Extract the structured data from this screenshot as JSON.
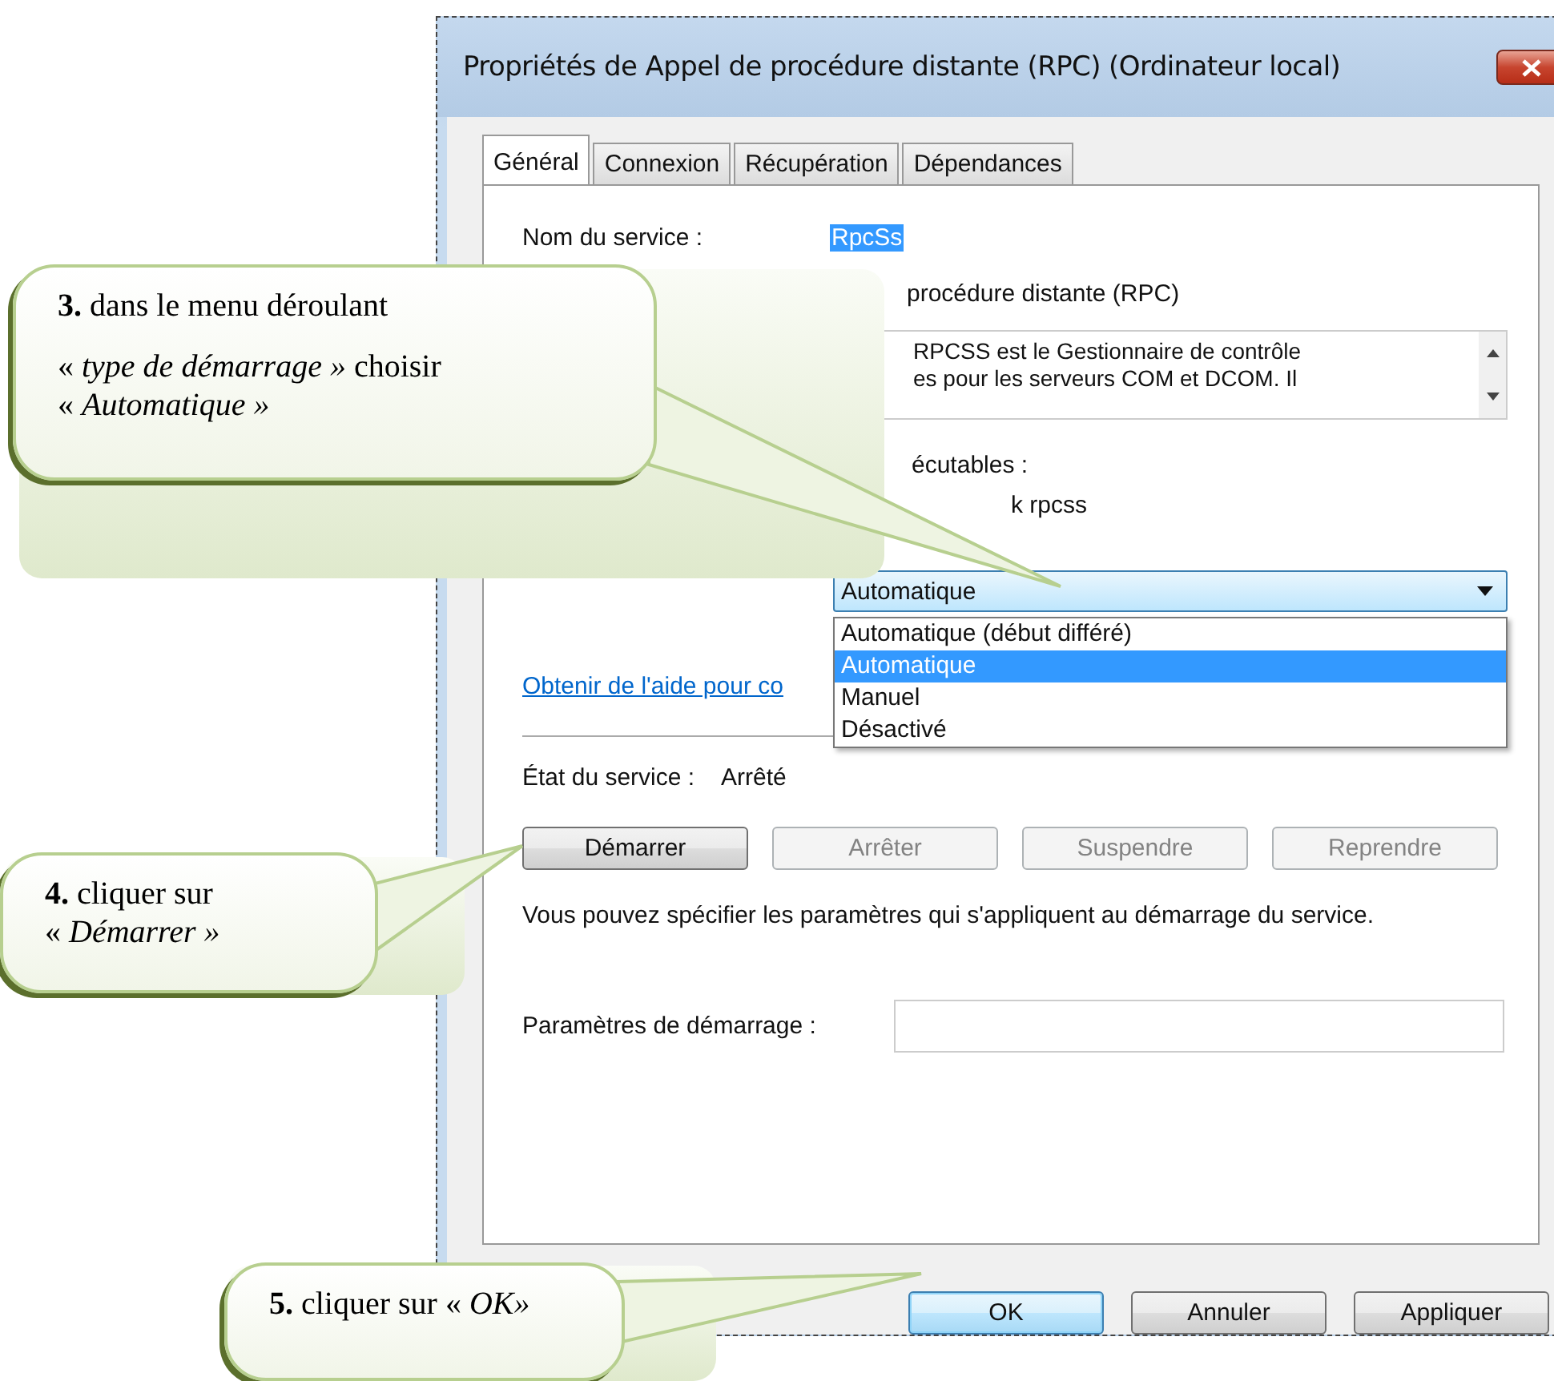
{
  "window": {
    "title": "Propriétés de Appel de procédure distante (RPC) (Ordinateur local)",
    "tabs": [
      {
        "label": "Général",
        "selected": true
      },
      {
        "label": "Connexion",
        "selected": false
      },
      {
        "label": "Récupération",
        "selected": false
      },
      {
        "label": "Dépendances",
        "selected": false
      }
    ]
  },
  "general": {
    "service_name_label": "Nom du service :",
    "service_name": "RpcSs",
    "display_name_fragment": "procédure distante (RPC)",
    "description_lines": [
      "RPCSS est le Gestionnaire de contrôle",
      "es pour les serveurs COM et DCOM. Il"
    ],
    "executable_label_fragment": "écutables :",
    "executable_fragment": "k rpcss",
    "startup_type": {
      "value": "Automatique",
      "expanded": true,
      "options": [
        {
          "label": "Automatique (début différé)",
          "selected": false
        },
        {
          "label": "Automatique",
          "selected": true
        },
        {
          "label": "Manuel",
          "selected": false
        },
        {
          "label": "Désactivé",
          "selected": false
        }
      ]
    },
    "help_link": "Obtenir de l'aide pour co",
    "status_label": "État du service :",
    "status": "Arrêté",
    "service_buttons": [
      {
        "label": "Démarrer",
        "disabled": false
      },
      {
        "label": "Arrêter",
        "disabled": true
      },
      {
        "label": "Suspendre",
        "disabled": true
      },
      {
        "label": "Reprendre",
        "disabled": true
      }
    ],
    "note": "Vous pouvez spécifier les paramètres qui s'appliquent au démarrage du service.",
    "start_params_label": "Paramètres de démarrage :"
  },
  "buttons": [
    {
      "label": "OK",
      "default": true
    },
    {
      "label": "Annuler",
      "default": false
    },
    {
      "label": "Appliquer",
      "default": false
    }
  ],
  "callouts": [
    {
      "paragraphs": [
        "**3.**  dans le menu déroulant",
        "«  *type de démarrage »* choisir « *Automatique »*"
      ]
    },
    {
      "paragraphs": [
        "**4.**  cliquer sur « *Démarrer »*"
      ]
    },
    {
      "paragraphs": [
        "**5.**  cliquer sur « *OK»*"
      ]
    }
  ]
}
